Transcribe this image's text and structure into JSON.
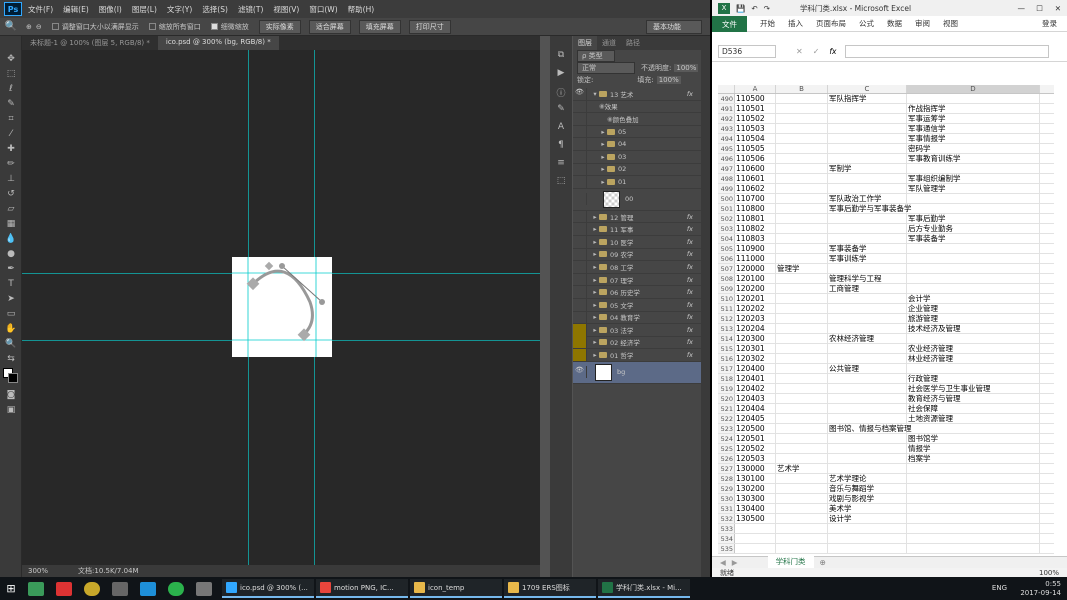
{
  "photoshop": {
    "logo": "Ps",
    "menu": [
      "文件(F)",
      "编辑(E)",
      "图像(I)",
      "图层(L)",
      "文字(Y)",
      "选择(S)",
      "滤镜(T)",
      "视图(V)",
      "窗口(W)",
      "帮助(H)"
    ],
    "options": {
      "resize_windows": "调整窗口大小以满屏显示",
      "zoom_all": "缩放所有窗口",
      "scrubby_zoom": "细微缩放",
      "btn_actual": "实际像素",
      "btn_fit": "适合屏幕",
      "btn_fill": "填充屏幕",
      "btn_print": "打印尺寸",
      "workspace": "基本功能"
    },
    "tabs": [
      "未标题-1 @ 100% (图层 5, RGB/8) *",
      "ico.psd @ 300% (bg, RGB/8) *"
    ],
    "status": {
      "zoom": "300%",
      "doc": "文档:10.5K/7.04M"
    },
    "panel": {
      "tabs": [
        "图层",
        "通道",
        "路径"
      ],
      "filter": "ρ 类型",
      "blend_mode": "正常",
      "opacity_label": "不透明度:",
      "opacity": "100%",
      "lock_label": "锁定:",
      "fill_label": "填充:",
      "fill": "100%",
      "layers": [
        {
          "name": "13 艺术",
          "fx": true,
          "open": true,
          "indent": 0
        },
        {
          "name": "效果",
          "indent": 1,
          "sub": true
        },
        {
          "name": "颜色叠加",
          "indent": 2,
          "sub": true
        },
        {
          "name": "05",
          "indent": 1
        },
        {
          "name": "04",
          "indent": 1
        },
        {
          "name": "03",
          "indent": 1
        },
        {
          "name": "02",
          "indent": 1
        },
        {
          "name": "01",
          "indent": 1
        },
        {
          "name": "00",
          "indent": 1,
          "thumb": true
        },
        {
          "name": "12 管理",
          "fx": true
        },
        {
          "name": "11 军事",
          "fx": true
        },
        {
          "name": "10 医学",
          "fx": true
        },
        {
          "name": "09 农学",
          "fx": true
        },
        {
          "name": "08 工学",
          "fx": true
        },
        {
          "name": "07 理学",
          "fx": true
        },
        {
          "name": "06 历史学",
          "fx": true
        },
        {
          "name": "05 文学",
          "fx": true
        },
        {
          "name": "04 教育学",
          "fx": true
        },
        {
          "name": "03 法学",
          "fx": true,
          "yellow": true
        },
        {
          "name": "02 经济学",
          "fx": true,
          "yellow": true
        },
        {
          "name": "01 哲学",
          "fx": true,
          "yellow": true
        },
        {
          "name": "bg",
          "bg": true
        }
      ]
    }
  },
  "excel": {
    "title": "学科门类.xlsx - Microsoft Excel",
    "ribbon_tabs": [
      "开始",
      "插入",
      "页面布局",
      "公式",
      "数据",
      "审阅",
      "视图"
    ],
    "file_tab": "文件",
    "login": "登录",
    "namebox": "D536",
    "fx_symbol": "fx",
    "columns": [
      "A",
      "B",
      "C",
      "D"
    ],
    "rows": [
      [
        "490",
        "110500",
        "",
        "军队指挥学",
        ""
      ],
      [
        "491",
        "110501",
        "",
        "",
        "作战指挥学"
      ],
      [
        "492",
        "110502",
        "",
        "",
        "军事运筹学"
      ],
      [
        "493",
        "110503",
        "",
        "",
        "军事通信学"
      ],
      [
        "494",
        "110504",
        "",
        "",
        "军事情报学"
      ],
      [
        "495",
        "110505",
        "",
        "",
        "密码学"
      ],
      [
        "496",
        "110506",
        "",
        "",
        "军事教育训练学"
      ],
      [
        "497",
        "110600",
        "",
        "军制学",
        ""
      ],
      [
        "498",
        "110601",
        "",
        "",
        "军事组织编制学"
      ],
      [
        "499",
        "110602",
        "",
        "",
        "军队管理学"
      ],
      [
        "500",
        "110700",
        "",
        "军队政治工作学",
        ""
      ],
      [
        "501",
        "110800",
        "",
        "军事后勤学与军事装备学",
        ""
      ],
      [
        "502",
        "110801",
        "",
        "",
        "军事后勤学"
      ],
      [
        "503",
        "110802",
        "",
        "",
        "后方专业勤务"
      ],
      [
        "504",
        "110803",
        "",
        "",
        "军事装备学"
      ],
      [
        "505",
        "110900",
        "",
        "军事装备学",
        ""
      ],
      [
        "506",
        "111000",
        "",
        "军事训练学",
        ""
      ],
      [
        "507",
        "120000",
        "管理学",
        "",
        ""
      ],
      [
        "508",
        "120100",
        "",
        "管理科学与工程",
        ""
      ],
      [
        "509",
        "120200",
        "",
        "工商管理",
        ""
      ],
      [
        "510",
        "120201",
        "",
        "",
        "会计学"
      ],
      [
        "511",
        "120202",
        "",
        "",
        "企业管理"
      ],
      [
        "512",
        "120203",
        "",
        "",
        "旅游管理"
      ],
      [
        "513",
        "120204",
        "",
        "",
        "技术经济及管理"
      ],
      [
        "514",
        "120300",
        "",
        "农林经济管理",
        ""
      ],
      [
        "515",
        "120301",
        "",
        "",
        "农业经济管理"
      ],
      [
        "516",
        "120302",
        "",
        "",
        "林业经济管理"
      ],
      [
        "517",
        "120400",
        "",
        "公共管理",
        ""
      ],
      [
        "518",
        "120401",
        "",
        "",
        "行政管理"
      ],
      [
        "519",
        "120402",
        "",
        "",
        "社会医学与卫生事业管理"
      ],
      [
        "520",
        "120403",
        "",
        "",
        "教育经济与管理"
      ],
      [
        "521",
        "120404",
        "",
        "",
        "社会保障"
      ],
      [
        "522",
        "120405",
        "",
        "",
        "土地资源管理"
      ],
      [
        "523",
        "120500",
        "",
        "图书馆、情报与档案管理",
        ""
      ],
      [
        "524",
        "120501",
        "",
        "",
        "图书馆学"
      ],
      [
        "525",
        "120502",
        "",
        "",
        "情报学"
      ],
      [
        "526",
        "120503",
        "",
        "",
        "档案学"
      ],
      [
        "527",
        "130000",
        "艺术学",
        "",
        ""
      ],
      [
        "528",
        "130100",
        "",
        "艺术学理论",
        ""
      ],
      [
        "529",
        "130200",
        "",
        "音乐与舞蹈学",
        ""
      ],
      [
        "530",
        "130300",
        "",
        "戏剧与影视学",
        ""
      ],
      [
        "531",
        "130400",
        "",
        "美术学",
        ""
      ],
      [
        "532",
        "130500",
        "",
        "设计学",
        ""
      ],
      [
        "533",
        "",
        "",
        "",
        ""
      ],
      [
        "534",
        "",
        "",
        "",
        ""
      ],
      [
        "535",
        "",
        "",
        "",
        ""
      ]
    ],
    "sheet_tab": "学科门类",
    "status_left": "就绪",
    "zoom": "100%"
  },
  "taskbar": {
    "items": [
      {
        "label": "ico.psd @ 300% (...",
        "color": "#31a8ff"
      },
      {
        "label": "motion PNG, IC...",
        "color": "#e8453c"
      },
      {
        "label": "icon_temp",
        "color": "#e8b84a"
      },
      {
        "label": "1709 ERS图标",
        "color": "#e8b84a"
      },
      {
        "label": "学科门类.xlsx - Mi...",
        "color": "#217346"
      }
    ],
    "lang": "ENG",
    "time": "0:55",
    "date": "2017-09-14"
  }
}
